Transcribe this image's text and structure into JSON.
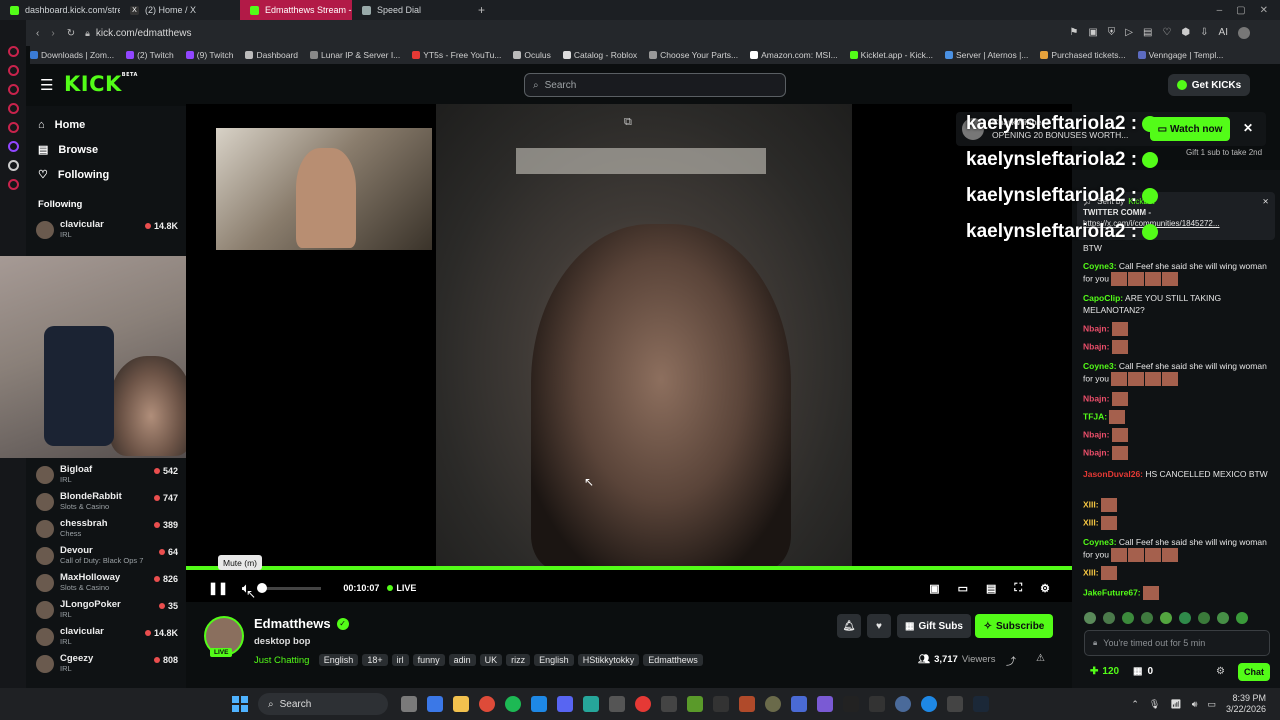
{
  "browser": {
    "tabs": [
      {
        "title": "dashboard.kick.com/strea",
        "active": false
      },
      {
        "title": "(2) Home / X",
        "active": false
      },
      {
        "title": "Edmatthews Stream -",
        "active": true
      },
      {
        "title": "Speed Dial",
        "active": false
      }
    ],
    "new_tab": "+",
    "url": "kick.com/edmatthews",
    "bookmarks": [
      {
        "label": "Downloads | Zom...",
        "color": "#3a7bd5"
      },
      {
        "label": "(2) Twitch",
        "color": "#9146ff"
      },
      {
        "label": "(9) Twitch",
        "color": "#9146ff"
      },
      {
        "label": "Dashboard",
        "color": "#bbbbbb"
      },
      {
        "label": "Lunar IP & Server I...",
        "color": "#888888"
      },
      {
        "label": "YT5s - Free YouTu...",
        "color": "#e53935"
      },
      {
        "label": "Oculus",
        "color": "#bbbbbb"
      },
      {
        "label": "Catalog - Roblox",
        "color": "#dddddd"
      },
      {
        "label": "Choose Your Parts...",
        "color": "#999999"
      },
      {
        "label": "Amazon.com: MSI...",
        "color": "#ffffff"
      },
      {
        "label": "Kicklet.app - Kick...",
        "color": "#53fc18"
      },
      {
        "label": "Server | Aternos |...",
        "color": "#4a90e2"
      },
      {
        "label": "Purchased tickets...",
        "color": "#e6a23c"
      },
      {
        "label": "Venngage | Templ...",
        "color": "#5c6bc0"
      }
    ],
    "toolbar_ai": "AI"
  },
  "kick": {
    "logo": "KICK",
    "logo_beta": "BETA",
    "search_placeholder": "Search",
    "get_kicks": "Get KICKs",
    "nav": [
      {
        "label": "Home",
        "icon": "home-icon"
      },
      {
        "label": "Browse",
        "icon": "browse-icon"
      },
      {
        "label": "Following",
        "icon": "heart-icon"
      }
    ],
    "following_header": "Following",
    "following": [
      {
        "name": "clavicular",
        "category": "IRL",
        "viewers": "14.8K"
      },
      {
        "name": "Bigloaf",
        "category": "IRL",
        "viewers": "542"
      },
      {
        "name": "BlondeRabbit",
        "category": "Slots & Casino",
        "viewers": "747"
      },
      {
        "name": "chessbrah",
        "category": "Chess",
        "viewers": "389"
      },
      {
        "name": "Devour",
        "category": "Call of Duty: Black Ops 7",
        "viewers": "64"
      },
      {
        "name": "MaxHolloway",
        "category": "Slots & Casino",
        "viewers": "826"
      },
      {
        "name": "JLongoPoker",
        "category": "IRL",
        "viewers": "35"
      },
      {
        "name": "clavicular",
        "category": "IRL",
        "viewers": "14.8K"
      },
      {
        "name": "Cgeezy",
        "category": "IRL",
        "viewers": "808"
      }
    ],
    "webcam_leftover_label": "IRL"
  },
  "player": {
    "tooltip": "Mute (m)",
    "time": "00:10:07",
    "live": "LIVE",
    "progress": 1.0,
    "volume": 0.0
  },
  "overlay": {
    "lines": [
      "kaelynsleftariola2 :",
      "kaelynsleftariola2 :",
      "kaelynsleftariola2 :",
      "kaelynsleftariola2 :"
    ],
    "banner_name": "CharkWinner3",
    "banner_text": "OPENING 20 BONUSES WORTH...",
    "watch_now": "Watch now",
    "gift_note": "Gift 1 sub to take 2nd",
    "pinned_sent_by": "Sent by",
    "pinned_sender": "Kickbot",
    "pinned_line1": "TWITTER COMM -",
    "pinned_line2": "https://x.com/i/communities/1845272..."
  },
  "chat": {
    "messages": [
      {
        "user": "",
        "text": "BTW",
        "color": "#e6e6e6",
        "emotes": 0
      },
      {
        "user": "Coyne3:",
        "text": "Call Feef she said she will wing woman for you",
        "color": "#53fc18",
        "emotes": 4
      },
      {
        "user": "CapoClip:",
        "text": "ARE YOU STILL TAKING MELANOTAN2?",
        "color": "#53fc18",
        "emotes": 0
      },
      {
        "user": "Nbajn:",
        "text": "",
        "color": "#ea4e6a",
        "emotes": 1
      },
      {
        "user": "Nbajn:",
        "text": "",
        "color": "#ea4e6a",
        "emotes": 1
      },
      {
        "user": "Coyne3:",
        "text": "Call Feef she said she will wing woman for you",
        "color": "#53fc18",
        "emotes": 4
      },
      {
        "user": "Nbajn:",
        "text": "",
        "color": "#ea4e6a",
        "emotes": 1
      },
      {
        "user": "TFJA:",
        "text": "",
        "color": "#53fc18",
        "emotes": 1
      },
      {
        "user": "Nbajn:",
        "text": "",
        "color": "#ea4e6a",
        "emotes": 1
      },
      {
        "user": "Nbajn:",
        "text": "",
        "color": "#ea4e6a",
        "emotes": 1
      },
      {
        "user": "JasonDuval26:",
        "text": "HS CANCELLED MEXICO BTW",
        "color": "#e53935",
        "emotes": 0
      },
      {
        "user": "XIII:",
        "text": "",
        "color": "#f4c542",
        "emotes": 1
      },
      {
        "user": "XIII:",
        "text": "",
        "color": "#f4c542",
        "emotes": 1
      },
      {
        "user": "Coyne3:",
        "text": "Call Feef she said she will wing woman for you",
        "color": "#53fc18",
        "emotes": 4
      },
      {
        "user": "XIII:",
        "text": "",
        "color": "#f4c542",
        "emotes": 1
      },
      {
        "user": "JakeFuture67:",
        "text": "",
        "color": "#53fc18",
        "emotes": 1
      }
    ],
    "input_placeholder": "You're timed out for 5 min",
    "points": "120",
    "gift_count": "0",
    "chat_button": "Chat"
  },
  "stream": {
    "streamer": "Edmatthews",
    "title": "desktop bop",
    "category": "Just Chatting",
    "tags": [
      "English",
      "18+",
      "irl",
      "funny",
      "adin",
      "UK",
      "rizz",
      "English",
      "HStikkytokky",
      "Edmatthews"
    ],
    "viewers": "3,717",
    "viewers_label": "Viewers",
    "live_badge": "LIVE",
    "gift_subs": "Gift Subs",
    "subscribe": "Subscribe"
  },
  "taskbar": {
    "search": "Search",
    "time": "8:39 PM",
    "date": "3/22/2026"
  },
  "colors": {
    "accent": "#53fc18",
    "active_tab": "#b21a47",
    "background": "#0b0e0f"
  }
}
